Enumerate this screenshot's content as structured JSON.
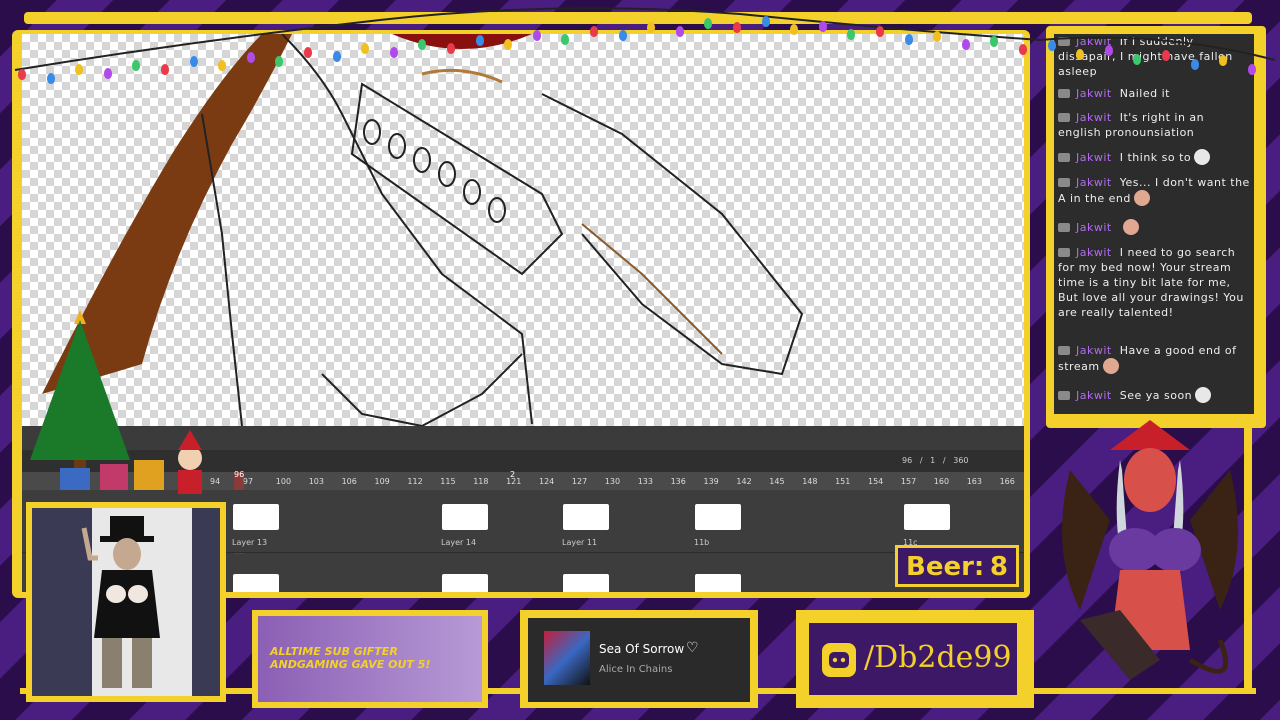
{
  "timeline": {
    "frame_counter": [
      "96",
      "/",
      "1",
      "/",
      "360"
    ],
    "ruler_ticks": [
      "94",
      "97",
      "100",
      "103",
      "106",
      "109",
      "112",
      "115",
      "118",
      "121",
      "124",
      "127",
      "130",
      "133",
      "136",
      "139",
      "142",
      "145",
      "148",
      "151",
      "154",
      "157",
      "160",
      "163",
      "166"
    ],
    "playhead_label": "96",
    "marker_label": "2",
    "layers": [
      "Layer 13",
      "Layer 14",
      "Layer 11",
      "11b",
      "11c"
    ]
  },
  "beer": {
    "label": "Beer:",
    "value": "8"
  },
  "chat": {
    "messages": [
      {
        "user": "Jakwit",
        "text": "If I suddenly dissapair, I might have fallen asleep"
      },
      {
        "user": "Jakwit",
        "text": "Nailed it"
      },
      {
        "user": "Jakwit",
        "text": "It's right in an english pronounsiation"
      },
      {
        "user": "Jakwit",
        "text": "I think so to"
      },
      {
        "user": "Jakwit",
        "text": "Yes... I don't want the A in the end"
      },
      {
        "user": "Jakwit",
        "text": ""
      },
      {
        "user": "Jakwit",
        "text": "I need to go search for my bed now! Your stream time is a tiny bit late for me, But love all your drawings! You are really talented!"
      },
      {
        "user": "Jakwit",
        "text": "Have a good end of stream"
      },
      {
        "user": "Jakwit",
        "text": "See ya soon"
      }
    ]
  },
  "gifter": {
    "line1": "ALLTIME SUB GIFTER",
    "line2": "ANDGAMING GAVE OUT 5!"
  },
  "music": {
    "song": "Sea Of Sorrow",
    "artist": "Alice In Chains"
  },
  "discord": {
    "handle": "/Db2de99"
  },
  "colors": {
    "frame": "#f3d02a",
    "purple": "#3c1866",
    "chat_user": "#b26cf0"
  }
}
